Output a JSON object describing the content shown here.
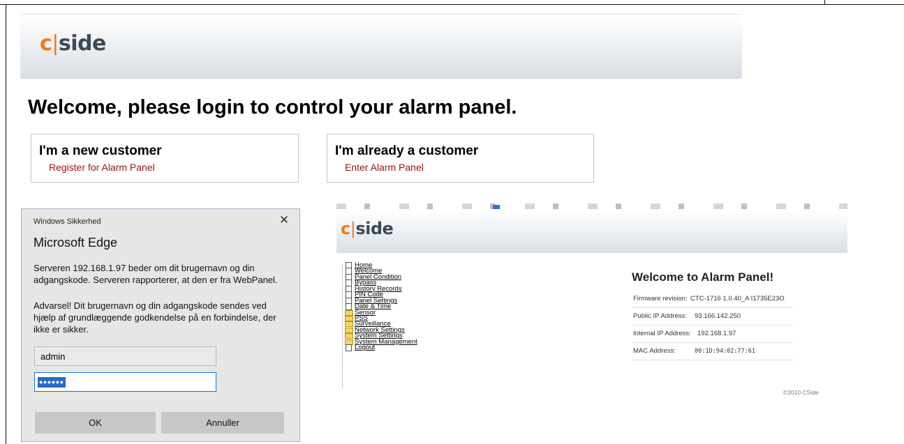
{
  "brand": {
    "logo_c": "c",
    "logo_bar": "|",
    "logo_rest": "side"
  },
  "login_page": {
    "heading": "Welcome, please login to control your alarm panel.",
    "new_customer": {
      "title": "I'm a new customer",
      "link": "Register for Alarm Panel"
    },
    "existing_customer": {
      "title": "I'm already a customer",
      "link": "Enter Alarm Panel"
    },
    "link_color": "#a01010"
  },
  "security_dialog": {
    "caption": "Windows Sikkerhed",
    "app": "Microsoft Edge",
    "message_1": "Serveren 192.168.1.97 beder om dit brugernavn og din adgangskode. Serveren rapporterer, at den er fra WebPanel.",
    "message_2": "Advarsel! Dit brugernavn og din adgangskode sendes ved hjælp af grundlæggende godkendelse på en forbindelse, der ikke er sikker.",
    "username": "admin",
    "password_mask": "●●●●●●",
    "ok_label": "OK",
    "cancel_label": "Annuller"
  },
  "alarm_panel": {
    "nav": [
      {
        "label": "Home",
        "icon": "page-icon"
      },
      {
        "label": "Welcome",
        "icon": "page-icon"
      },
      {
        "label": "Panel Condition",
        "icon": "page-icon"
      },
      {
        "label": "Bypass",
        "icon": "page-icon"
      },
      {
        "label": "History Records",
        "icon": "page-icon"
      },
      {
        "label": "PIN Code",
        "icon": "page-icon"
      },
      {
        "label": "Panel Settings",
        "icon": "page-icon"
      },
      {
        "label": "Date & Time",
        "icon": "page-icon"
      },
      {
        "label": "Sensor",
        "icon": "folder-icon"
      },
      {
        "label": "PSS",
        "icon": "folder-icon"
      },
      {
        "label": "Surveillance",
        "icon": "folder-icon"
      },
      {
        "label": "Network Settings",
        "icon": "folder-icon"
      },
      {
        "label": "System Settings",
        "icon": "folder-icon"
      },
      {
        "label": "System Management",
        "icon": "folder-icon"
      },
      {
        "label": "Logout",
        "icon": "page-icon"
      }
    ],
    "title": "Welcome to Alarm Panel!",
    "info": {
      "firmware": {
        "label": "Firmware revision:",
        "value": "CTC-1716 1.0.40_A I1735E23O"
      },
      "public_ip": {
        "label": "Public IP Address:",
        "value": "93.166.142.250"
      },
      "internal_ip": {
        "label": "Internal IP Address:",
        "value": "192.168.1.97"
      },
      "mac": {
        "label": "MAC Address:",
        "value": "00:1D:94:02:77:61"
      }
    },
    "copyright": "©2010 CSide"
  },
  "colors": {
    "accent_orange": "#f0781e",
    "logo_gray": "#3c4a57",
    "selection_blue": "#2a69c7"
  }
}
